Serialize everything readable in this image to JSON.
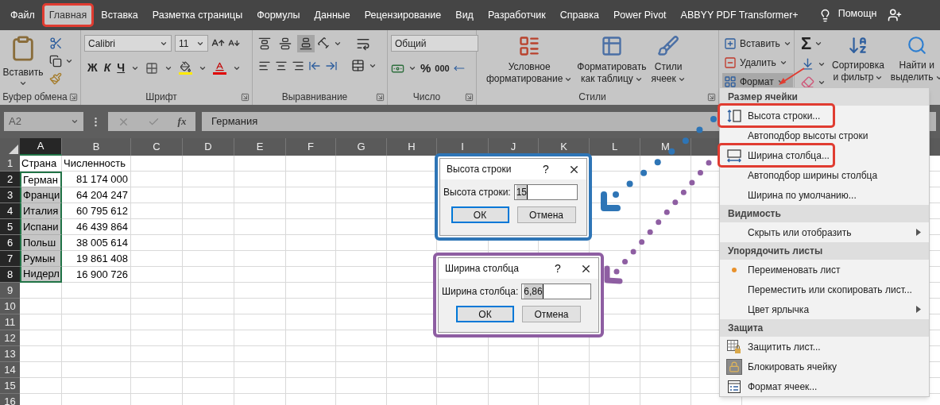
{
  "tabs": [
    {
      "label": "Файл",
      "selected": false,
      "highlighted": false
    },
    {
      "label": "Главная",
      "selected": true,
      "highlighted": true
    },
    {
      "label": "Вставка",
      "selected": false,
      "highlighted": false
    },
    {
      "label": "Разметка страницы",
      "selected": false,
      "highlighted": false
    },
    {
      "label": "Формулы",
      "selected": false,
      "highlighted": false
    },
    {
      "label": "Данные",
      "selected": false,
      "highlighted": false
    },
    {
      "label": "Рецензирование",
      "selected": false,
      "highlighted": false
    },
    {
      "label": "Вид",
      "selected": false,
      "highlighted": false
    },
    {
      "label": "Разработчик",
      "selected": false,
      "highlighted": false
    },
    {
      "label": "Справка",
      "selected": false,
      "highlighted": false
    },
    {
      "label": "Power Pivot",
      "selected": false,
      "highlighted": false
    },
    {
      "label": "ABBYY PDF Transformer+",
      "selected": false,
      "highlighted": false
    }
  ],
  "tell_me": "Помощн",
  "clipboard": {
    "label": "Буфер обмена",
    "paste": "Вставить"
  },
  "font": {
    "label": "Шрифт",
    "name": "Calibri",
    "size": "11",
    "bold": "Ж",
    "italic": "К",
    "underline": "Ч"
  },
  "alignment": {
    "label": "Выравнивание",
    "vertical": [
      {
        "kind": "top",
        "selected": false
      },
      {
        "kind": "middle",
        "selected": false
      },
      {
        "kind": "bottom",
        "selected": true
      }
    ]
  },
  "number": {
    "label": "Число",
    "format": "Общий",
    "percent": "%",
    "thousands": "000"
  },
  "styles": {
    "label": "Стили",
    "buttons": [
      {
        "kind": "conditional",
        "lines": [
          "Условное",
          "форматирование"
        ]
      },
      {
        "kind": "table",
        "lines": [
          "Форматировать",
          "как таблицу"
        ]
      },
      {
        "kind": "cell-styles",
        "lines": [
          "Стили",
          "ячеек"
        ]
      }
    ]
  },
  "cells": {
    "buttons": [
      {
        "kind": "insert",
        "label": "Вставить",
        "selected": false
      },
      {
        "kind": "delete",
        "label": "Удалить",
        "selected": false
      },
      {
        "kind": "format",
        "label": "Формат",
        "selected": true
      }
    ]
  },
  "editing": {
    "sum": "Σ",
    "buttons": [
      {
        "kind": "sort",
        "lines": [
          "Сортировка",
          "и фильтр"
        ]
      },
      {
        "kind": "find",
        "lines": [
          "Найти и",
          "выделить"
        ]
      }
    ]
  },
  "formula_bar": {
    "name_box": "A2",
    "function": "fx",
    "value": "Германия"
  },
  "sheet": {
    "columns": [
      {
        "label": "A",
        "selected": true
      },
      {
        "label": "B",
        "selected": false
      },
      {
        "label": "C",
        "selected": false
      },
      {
        "label": "D",
        "selected": false
      },
      {
        "label": "E",
        "selected": false
      },
      {
        "label": "F",
        "selected": false
      },
      {
        "label": "G",
        "selected": false
      },
      {
        "label": "H",
        "selected": false
      },
      {
        "label": "I",
        "selected": false
      },
      {
        "label": "J",
        "selected": false
      },
      {
        "label": "K",
        "selected": false
      },
      {
        "label": "L",
        "selected": false
      },
      {
        "label": "M",
        "selected": false
      }
    ],
    "rows": [
      {
        "number": "1",
        "selected": false,
        "cells": [
          {
            "text": "Страна",
            "kind": "text",
            "selected": false
          },
          {
            "text": "Численность",
            "kind": "text",
            "selected": false
          }
        ]
      },
      {
        "number": "2",
        "selected": true,
        "cells": [
          {
            "text": "Герман",
            "kind": "text",
            "selected": true
          },
          {
            "text": "81 174 000",
            "kind": "number",
            "selected": false
          }
        ]
      },
      {
        "number": "3",
        "selected": true,
        "cells": [
          {
            "text": "Франци",
            "kind": "text",
            "selected": true
          },
          {
            "text": "64 204 247",
            "kind": "number",
            "selected": false
          }
        ]
      },
      {
        "number": "4",
        "selected": true,
        "cells": [
          {
            "text": "Италия",
            "kind": "text",
            "selected": true
          },
          {
            "text": "60 795 612",
            "kind": "number",
            "selected": false
          }
        ]
      },
      {
        "number": "5",
        "selected": true,
        "cells": [
          {
            "text": "Испани",
            "kind": "text",
            "selected": true
          },
          {
            "text": "46 439 864",
            "kind": "number",
            "selected": false
          }
        ]
      },
      {
        "number": "6",
        "selected": true,
        "cells": [
          {
            "text": "Польш",
            "kind": "text",
            "selected": true
          },
          {
            "text": "38 005 614",
            "kind": "number",
            "selected": false
          }
        ]
      },
      {
        "number": "7",
        "selected": true,
        "cells": [
          {
            "text": "Румын",
            "kind": "text",
            "selected": true
          },
          {
            "text": "19 861 408",
            "kind": "number",
            "selected": false
          }
        ]
      },
      {
        "number": "8",
        "selected": true,
        "cells": [
          {
            "text": "Нидерл",
            "kind": "text",
            "selected": true
          },
          {
            "text": "16 900 726",
            "kind": "number",
            "selected": false
          }
        ]
      },
      {
        "number": "9",
        "selected": false
      },
      {
        "number": "10",
        "selected": false
      },
      {
        "number": "11",
        "selected": false
      },
      {
        "number": "12",
        "selected": false
      },
      {
        "number": "13",
        "selected": false
      },
      {
        "number": "14",
        "selected": false
      },
      {
        "number": "15",
        "selected": false
      },
      {
        "number": "16",
        "selected": false
      }
    ]
  },
  "dialogs": [
    {
      "title": "Высота строки",
      "help": "?",
      "label": "Высота строки:",
      "value": "15",
      "ok": "ОК",
      "cancel": "Отмена",
      "color": "#2e75b6"
    },
    {
      "title": "Ширина столбца",
      "help": "?",
      "label": "Ширина столбца:",
      "value": "6,86",
      "ok": "ОК",
      "cancel": "Отмена",
      "color": "#8e5ea2"
    }
  ],
  "format_menu": {
    "sections": [
      {
        "title": "Размер ячейки",
        "items": [
          {
            "label": "Высота строки...",
            "kind": "row-height",
            "highlighted": true
          },
          {
            "label": "Автоподбор высоты строки",
            "kind": "plain",
            "highlighted": false
          },
          {
            "label": "Ширина столбца...",
            "kind": "column-width",
            "highlighted": true
          },
          {
            "label": "Автоподбор ширины столбца",
            "kind": "plain",
            "highlighted": false
          },
          {
            "label": "Ширина по умолчанию...",
            "kind": "plain",
            "highlighted": false
          }
        ]
      },
      {
        "title": "Видимость",
        "items": [
          {
            "label": "Скрыть или отобразить",
            "kind": "submenu",
            "highlighted": false
          }
        ]
      },
      {
        "title": "Упорядочить листы",
        "items": [
          {
            "label": "Переименовать лист",
            "kind": "bullet",
            "highlighted": false
          },
          {
            "label": "Переместить или скопировать лист...",
            "kind": "plain",
            "highlighted": false
          },
          {
            "label": "Цвет ярлычка",
            "kind": "submenu",
            "highlighted": false
          }
        ]
      },
      {
        "title": "Защита",
        "items": [
          {
            "label": "Защитить лист...",
            "kind": "protect-sheet",
            "highlighted": false
          },
          {
            "label": "Блокировать ячейку",
            "kind": "lock",
            "highlighted": false
          },
          {
            "label": "Формат ячеек...",
            "kind": "format-cells",
            "highlighted": false
          }
        ]
      }
    ]
  }
}
